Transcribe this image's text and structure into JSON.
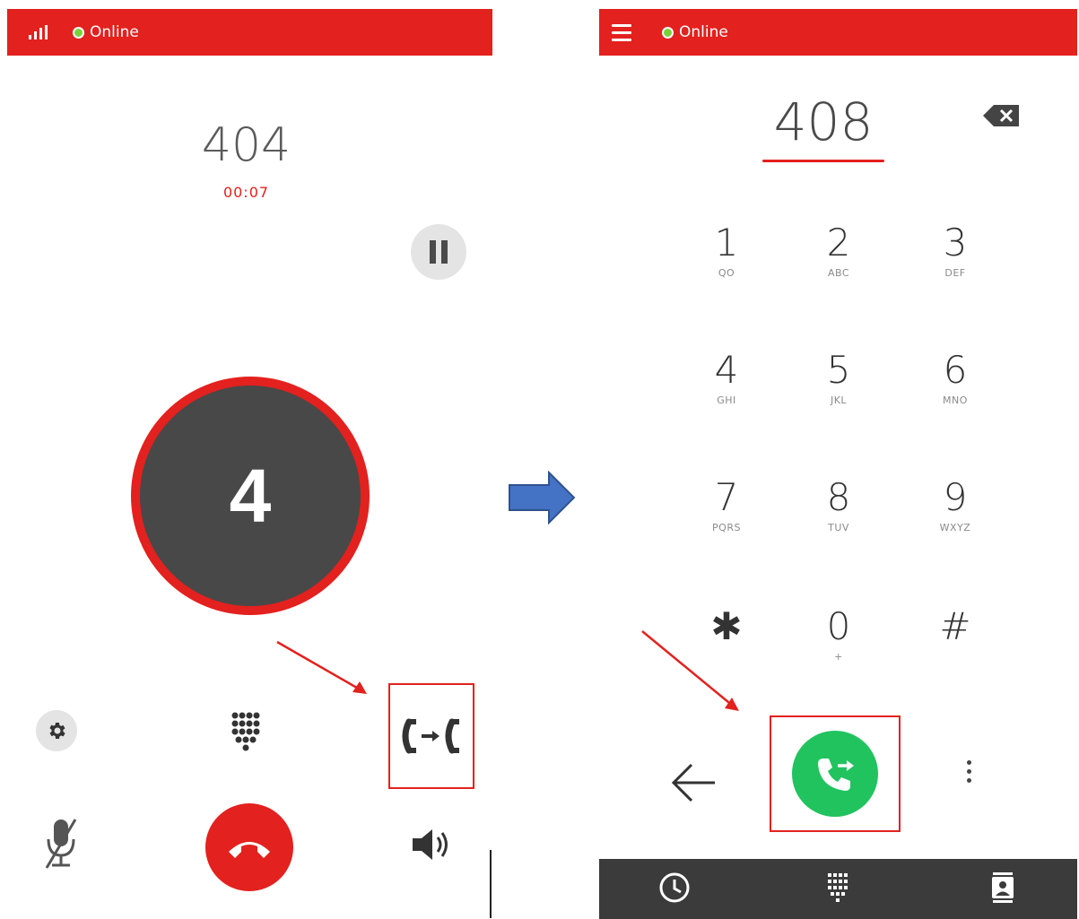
{
  "left_screen": {
    "status": {
      "text": "Online",
      "icons": [
        "signal-icon"
      ]
    },
    "call": {
      "callee": "404",
      "timer": "00:07",
      "avatar_letter": "4"
    },
    "controls": [
      "gear-icon",
      "dialpad-icon",
      "call-transfer-icon",
      "mute-icon",
      "hangup-icon",
      "speaker-icon"
    ]
  },
  "right_screen": {
    "status": {
      "text": "Online",
      "icons": [
        "menu-icon"
      ]
    },
    "dial_number": "408",
    "keypad": [
      {
        "digit": "1",
        "letters": "QO"
      },
      {
        "digit": "2",
        "letters": "ABC"
      },
      {
        "digit": "3",
        "letters": "DEF"
      },
      {
        "digit": "4",
        "letters": "GHI"
      },
      {
        "digit": "5",
        "letters": "JKL"
      },
      {
        "digit": "6",
        "letters": "MNO"
      },
      {
        "digit": "7",
        "letters": "PQRS"
      },
      {
        "digit": "8",
        "letters": "TUV"
      },
      {
        "digit": "9",
        "letters": "WXYZ"
      },
      {
        "digit": "✱",
        "letters": ""
      },
      {
        "digit": "0",
        "letters": "+"
      },
      {
        "digit": "#",
        "letters": ""
      }
    ],
    "actions": [
      "back-arrow-icon",
      "transfer-call-icon",
      "more-vertical-icon"
    ],
    "bottom_nav": [
      "clock-icon",
      "dialpad-icon",
      "contacts-icon"
    ]
  },
  "colors": {
    "brand_red": "#e3211e",
    "online_green": "#7ad23a",
    "call_green": "#21c35f",
    "nav_dark": "#3b3b3b",
    "arrow_blue": "#4472c4"
  }
}
